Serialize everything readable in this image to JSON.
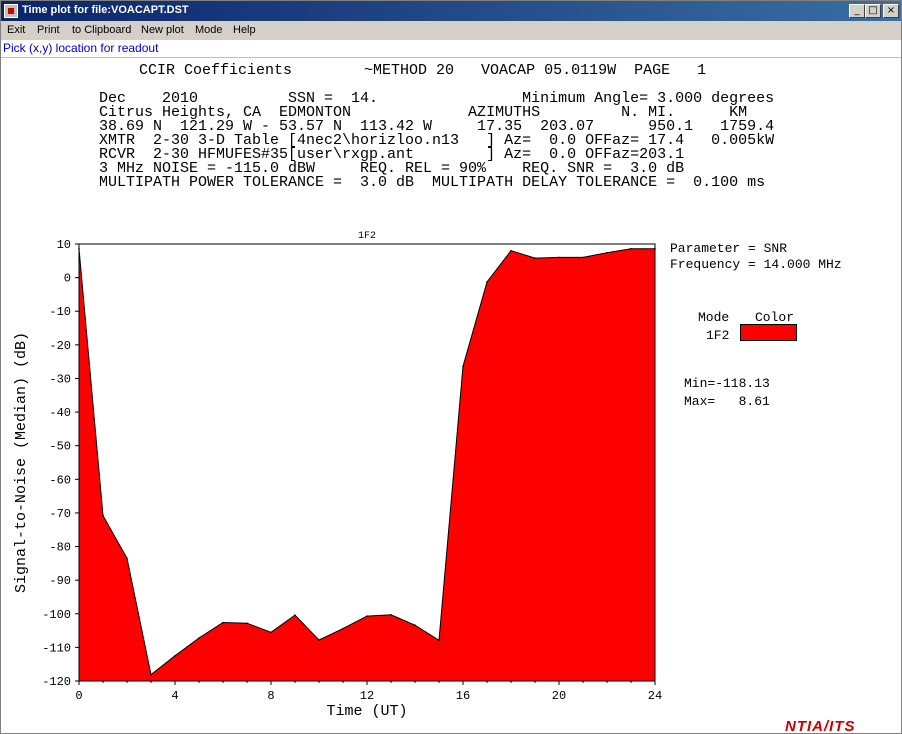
{
  "window": {
    "title": "Time plot for file:VOACAPT.DST"
  },
  "window_buttons": {
    "minimize": "_",
    "maximize": "□",
    "close": "×"
  },
  "menu": [
    "Exit",
    "Print",
    "to Clipboard",
    "New plot",
    "Mode",
    "Help"
  ],
  "status": "Pick (x,y) location for readout",
  "header": {
    "line1": "CCIR Coefficients        ~METHOD 20   VOACAP 05.0119W  PAGE   1",
    "line2": "Dec    2010          SSN =  14.                Minimum Angle= 3.000 degrees",
    "line3": "Citrus Heights, CA  EDMONTON             AZIMUTHS         N. MI.      KM",
    "line4": "38.69 N  121.29 W - 53.57 N  113.42 W     17.35  203.07      950.1   1759.4",
    "line5": "XMTR  2-30 3-D Table [4nec2\\horizloo.n13   ] Az=  0.0 OFFaz= 17.4   0.005kW",
    "line6": "RCVR  2-30 HFMUFES#35[user\\rxgp.ant        ] Az=  0.0 OFFaz=203.1",
    "line7": "3 MHz NOISE = -115.0 dBW     REQ. REL = 90%    REQ. SNR =  3.0 dB",
    "line8": "MULTIPATH POWER TOLERANCE =  3.0 dB  MULTIPATH DELAY TOLERANCE =  0.100 ms"
  },
  "side_info": {
    "parameter": "Parameter = SNR",
    "frequency": "Frequency = 14.000 MHz",
    "legend_mode_header": "Mode",
    "legend_color_header": "Color",
    "legend_mode": "1F2",
    "legend_color": "#ff0000",
    "min": "Min=-118.13",
    "max": "Max=   8.61"
  },
  "footer_logo": "NTIA/ITS",
  "chart_data": {
    "type": "area",
    "title": "1F2",
    "xlabel": "Time (UT)",
    "ylabel": "Signal-to-Noise (Median) (dB)",
    "xlim": [
      0,
      24
    ],
    "ylim": [
      -120,
      10
    ],
    "xticks": [
      0,
      4,
      8,
      12,
      16,
      20,
      24
    ],
    "yticks": [
      10,
      0,
      -10,
      -20,
      -30,
      -40,
      -50,
      -60,
      -70,
      -80,
      -90,
      -100,
      -110,
      -120
    ],
    "series": [
      {
        "name": "1F2",
        "color": "#ff0000",
        "x": [
          0,
          1,
          2,
          3,
          4,
          5,
          6,
          7,
          8,
          9,
          10,
          11,
          12,
          13,
          14,
          15,
          16,
          17,
          18,
          19,
          20,
          21,
          22,
          23,
          24
        ],
        "y": [
          8.6,
          -70.8,
          -83.5,
          -118.1,
          -112.5,
          -107.2,
          -102.6,
          -102.8,
          -105.5,
          -100.4,
          -107.8,
          -104.4,
          -100.7,
          -100.3,
          -103.4,
          -107.9,
          -26.4,
          -1.3,
          8.0,
          5.8,
          6.0,
          6.0,
          7.4,
          8.6,
          8.6
        ]
      }
    ]
  }
}
